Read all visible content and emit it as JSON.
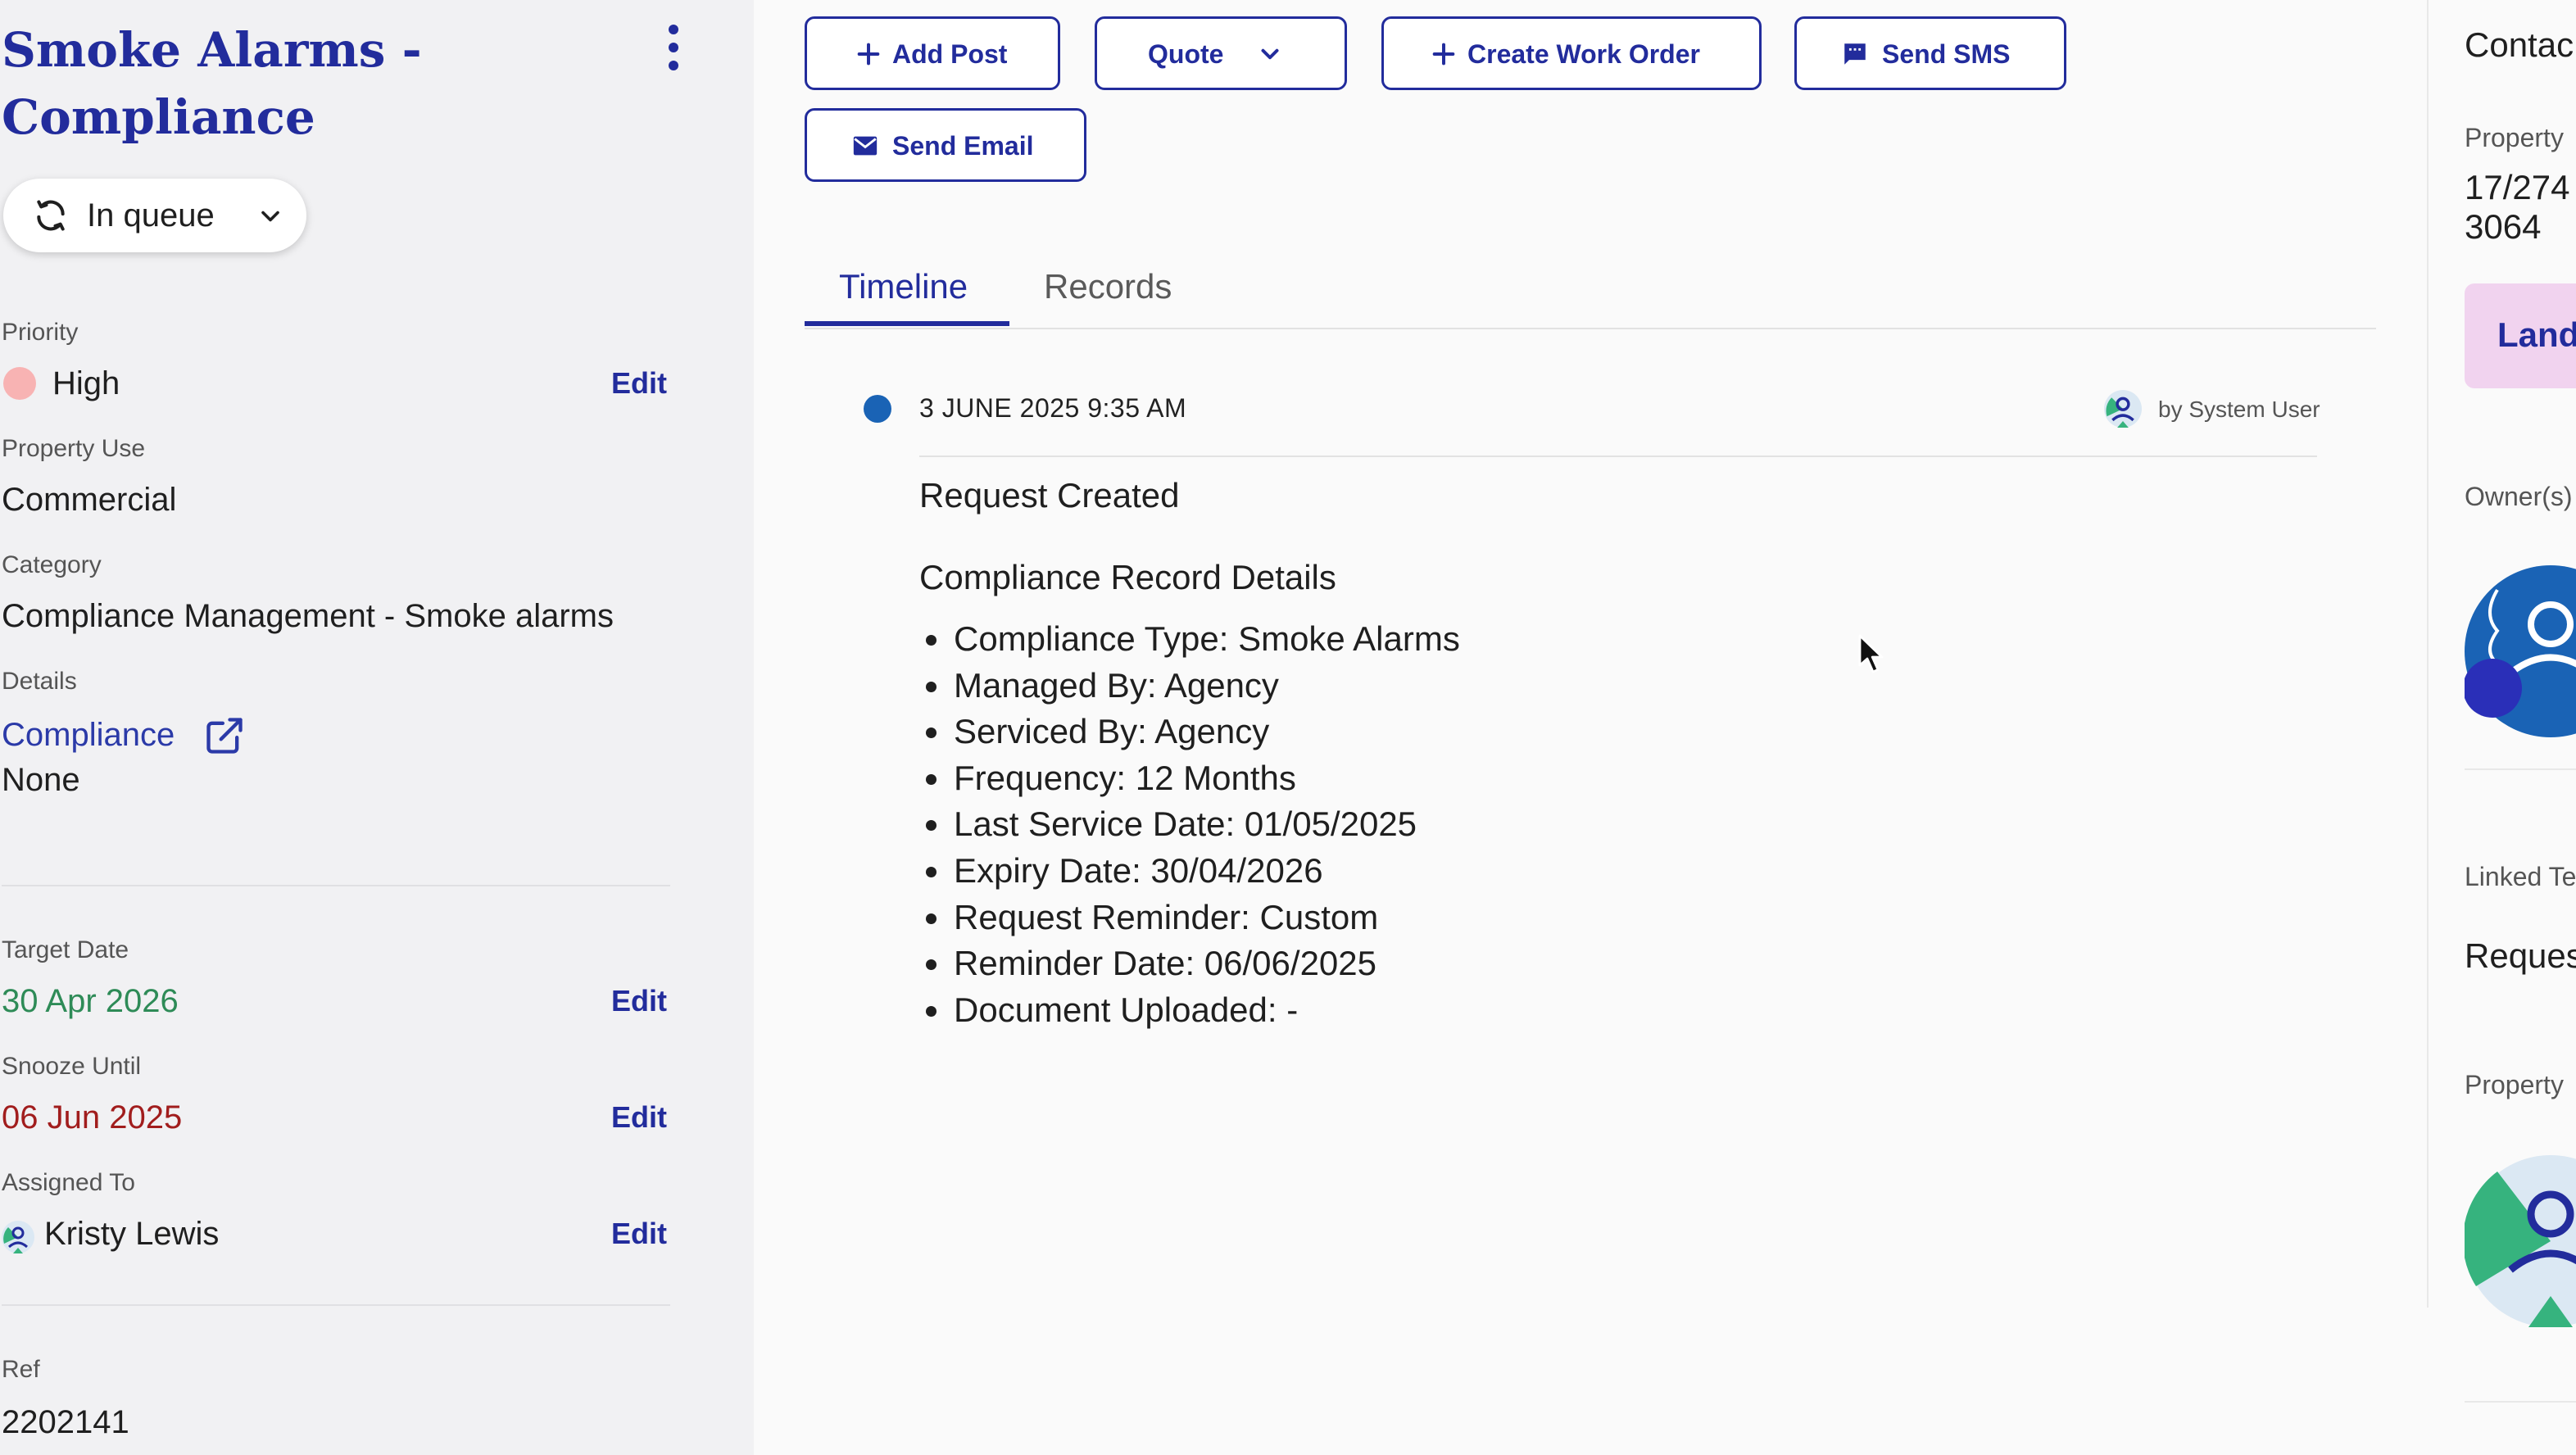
{
  "sidebar": {
    "title": "Smoke Alarms - Compliance",
    "status": "In queue",
    "priority": {
      "label": "Priority",
      "value": "High",
      "edit": "Edit",
      "color": "#f8b3b3"
    },
    "property_use": {
      "label": "Property Use",
      "value": "Commercial"
    },
    "category": {
      "label": "Category",
      "value": "Compliance Management - Smoke alarms"
    },
    "details": {
      "label": "Details",
      "link": "Compliance",
      "value": "None"
    },
    "target_date": {
      "label": "Target Date",
      "value": "30 Apr 2026",
      "edit": "Edit",
      "color": "#2e8b57"
    },
    "snooze_until": {
      "label": "Snooze Until",
      "value": "06 Jun 2025",
      "edit": "Edit",
      "color": "#a11d1d"
    },
    "assigned_to": {
      "label": "Assigned To",
      "value": "Kristy Lewis",
      "edit": "Edit"
    },
    "ref": {
      "label": "Ref",
      "value": "2202141"
    }
  },
  "toolbar": {
    "add_post": "Add Post",
    "quote": "Quote",
    "create_work_order": "Create Work Order",
    "send_sms": "Send SMS",
    "send_email": "Send Email"
  },
  "tabs": [
    {
      "label": "Timeline",
      "active": true
    },
    {
      "label": "Records",
      "active": false
    }
  ],
  "timeline": {
    "date": "3 JUNE 2025 9:35 AM",
    "user": "by System User",
    "title": "Request Created",
    "subtitle": "Compliance Record Details",
    "items": [
      "Compliance Type: Smoke Alarms",
      "Managed By: Agency",
      "Serviced By: Agency",
      "Frequency: 12 Months",
      "Last Service Date: 01/05/2025",
      "Expiry Date: 30/04/2026",
      "Request Reminder: Custom",
      "Reminder Date: 06/06/2025",
      "Document Uploaded: -"
    ]
  },
  "right_panel": {
    "heading": "Contac",
    "property_label": "Property",
    "address_line1": "17/274",
    "address_line2": "3064",
    "landlord_button": "Land",
    "owners_label": "Owner(s)",
    "linked_label": "Linked Te",
    "linked_value": "Reques",
    "property_label2": "Property"
  },
  "colors": {
    "brand": "#222c9c",
    "timeline_dot": "#1a63b5",
    "sidebar_bg": "#f1f1f3",
    "landlord_bg": "#f1d3ef"
  }
}
